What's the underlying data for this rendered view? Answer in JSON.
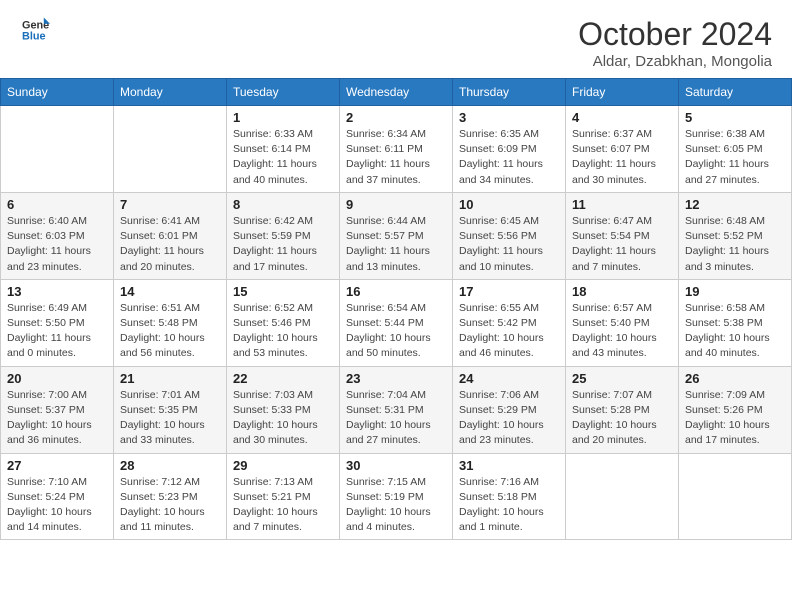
{
  "header": {
    "logo_line1": "General",
    "logo_line2": "Blue",
    "month_title": "October 2024",
    "subtitle": "Aldar, Dzabkhan, Mongolia"
  },
  "days_of_week": [
    "Sunday",
    "Monday",
    "Tuesday",
    "Wednesday",
    "Thursday",
    "Friday",
    "Saturday"
  ],
  "weeks": [
    [
      {
        "day": "",
        "info": ""
      },
      {
        "day": "",
        "info": ""
      },
      {
        "day": "1",
        "info": "Sunrise: 6:33 AM\nSunset: 6:14 PM\nDaylight: 11 hours and 40 minutes."
      },
      {
        "day": "2",
        "info": "Sunrise: 6:34 AM\nSunset: 6:11 PM\nDaylight: 11 hours and 37 minutes."
      },
      {
        "day": "3",
        "info": "Sunrise: 6:35 AM\nSunset: 6:09 PM\nDaylight: 11 hours and 34 minutes."
      },
      {
        "day": "4",
        "info": "Sunrise: 6:37 AM\nSunset: 6:07 PM\nDaylight: 11 hours and 30 minutes."
      },
      {
        "day": "5",
        "info": "Sunrise: 6:38 AM\nSunset: 6:05 PM\nDaylight: 11 hours and 27 minutes."
      }
    ],
    [
      {
        "day": "6",
        "info": "Sunrise: 6:40 AM\nSunset: 6:03 PM\nDaylight: 11 hours and 23 minutes."
      },
      {
        "day": "7",
        "info": "Sunrise: 6:41 AM\nSunset: 6:01 PM\nDaylight: 11 hours and 20 minutes."
      },
      {
        "day": "8",
        "info": "Sunrise: 6:42 AM\nSunset: 5:59 PM\nDaylight: 11 hours and 17 minutes."
      },
      {
        "day": "9",
        "info": "Sunrise: 6:44 AM\nSunset: 5:57 PM\nDaylight: 11 hours and 13 minutes."
      },
      {
        "day": "10",
        "info": "Sunrise: 6:45 AM\nSunset: 5:56 PM\nDaylight: 11 hours and 10 minutes."
      },
      {
        "day": "11",
        "info": "Sunrise: 6:47 AM\nSunset: 5:54 PM\nDaylight: 11 hours and 7 minutes."
      },
      {
        "day": "12",
        "info": "Sunrise: 6:48 AM\nSunset: 5:52 PM\nDaylight: 11 hours and 3 minutes."
      }
    ],
    [
      {
        "day": "13",
        "info": "Sunrise: 6:49 AM\nSunset: 5:50 PM\nDaylight: 11 hours and 0 minutes."
      },
      {
        "day": "14",
        "info": "Sunrise: 6:51 AM\nSunset: 5:48 PM\nDaylight: 10 hours and 56 minutes."
      },
      {
        "day": "15",
        "info": "Sunrise: 6:52 AM\nSunset: 5:46 PM\nDaylight: 10 hours and 53 minutes."
      },
      {
        "day": "16",
        "info": "Sunrise: 6:54 AM\nSunset: 5:44 PM\nDaylight: 10 hours and 50 minutes."
      },
      {
        "day": "17",
        "info": "Sunrise: 6:55 AM\nSunset: 5:42 PM\nDaylight: 10 hours and 46 minutes."
      },
      {
        "day": "18",
        "info": "Sunrise: 6:57 AM\nSunset: 5:40 PM\nDaylight: 10 hours and 43 minutes."
      },
      {
        "day": "19",
        "info": "Sunrise: 6:58 AM\nSunset: 5:38 PM\nDaylight: 10 hours and 40 minutes."
      }
    ],
    [
      {
        "day": "20",
        "info": "Sunrise: 7:00 AM\nSunset: 5:37 PM\nDaylight: 10 hours and 36 minutes."
      },
      {
        "day": "21",
        "info": "Sunrise: 7:01 AM\nSunset: 5:35 PM\nDaylight: 10 hours and 33 minutes."
      },
      {
        "day": "22",
        "info": "Sunrise: 7:03 AM\nSunset: 5:33 PM\nDaylight: 10 hours and 30 minutes."
      },
      {
        "day": "23",
        "info": "Sunrise: 7:04 AM\nSunset: 5:31 PM\nDaylight: 10 hours and 27 minutes."
      },
      {
        "day": "24",
        "info": "Sunrise: 7:06 AM\nSunset: 5:29 PM\nDaylight: 10 hours and 23 minutes."
      },
      {
        "day": "25",
        "info": "Sunrise: 7:07 AM\nSunset: 5:28 PM\nDaylight: 10 hours and 20 minutes."
      },
      {
        "day": "26",
        "info": "Sunrise: 7:09 AM\nSunset: 5:26 PM\nDaylight: 10 hours and 17 minutes."
      }
    ],
    [
      {
        "day": "27",
        "info": "Sunrise: 7:10 AM\nSunset: 5:24 PM\nDaylight: 10 hours and 14 minutes."
      },
      {
        "day": "28",
        "info": "Sunrise: 7:12 AM\nSunset: 5:23 PM\nDaylight: 10 hours and 11 minutes."
      },
      {
        "day": "29",
        "info": "Sunrise: 7:13 AM\nSunset: 5:21 PM\nDaylight: 10 hours and 7 minutes."
      },
      {
        "day": "30",
        "info": "Sunrise: 7:15 AM\nSunset: 5:19 PM\nDaylight: 10 hours and 4 minutes."
      },
      {
        "day": "31",
        "info": "Sunrise: 7:16 AM\nSunset: 5:18 PM\nDaylight: 10 hours and 1 minute."
      },
      {
        "day": "",
        "info": ""
      },
      {
        "day": "",
        "info": ""
      }
    ]
  ]
}
